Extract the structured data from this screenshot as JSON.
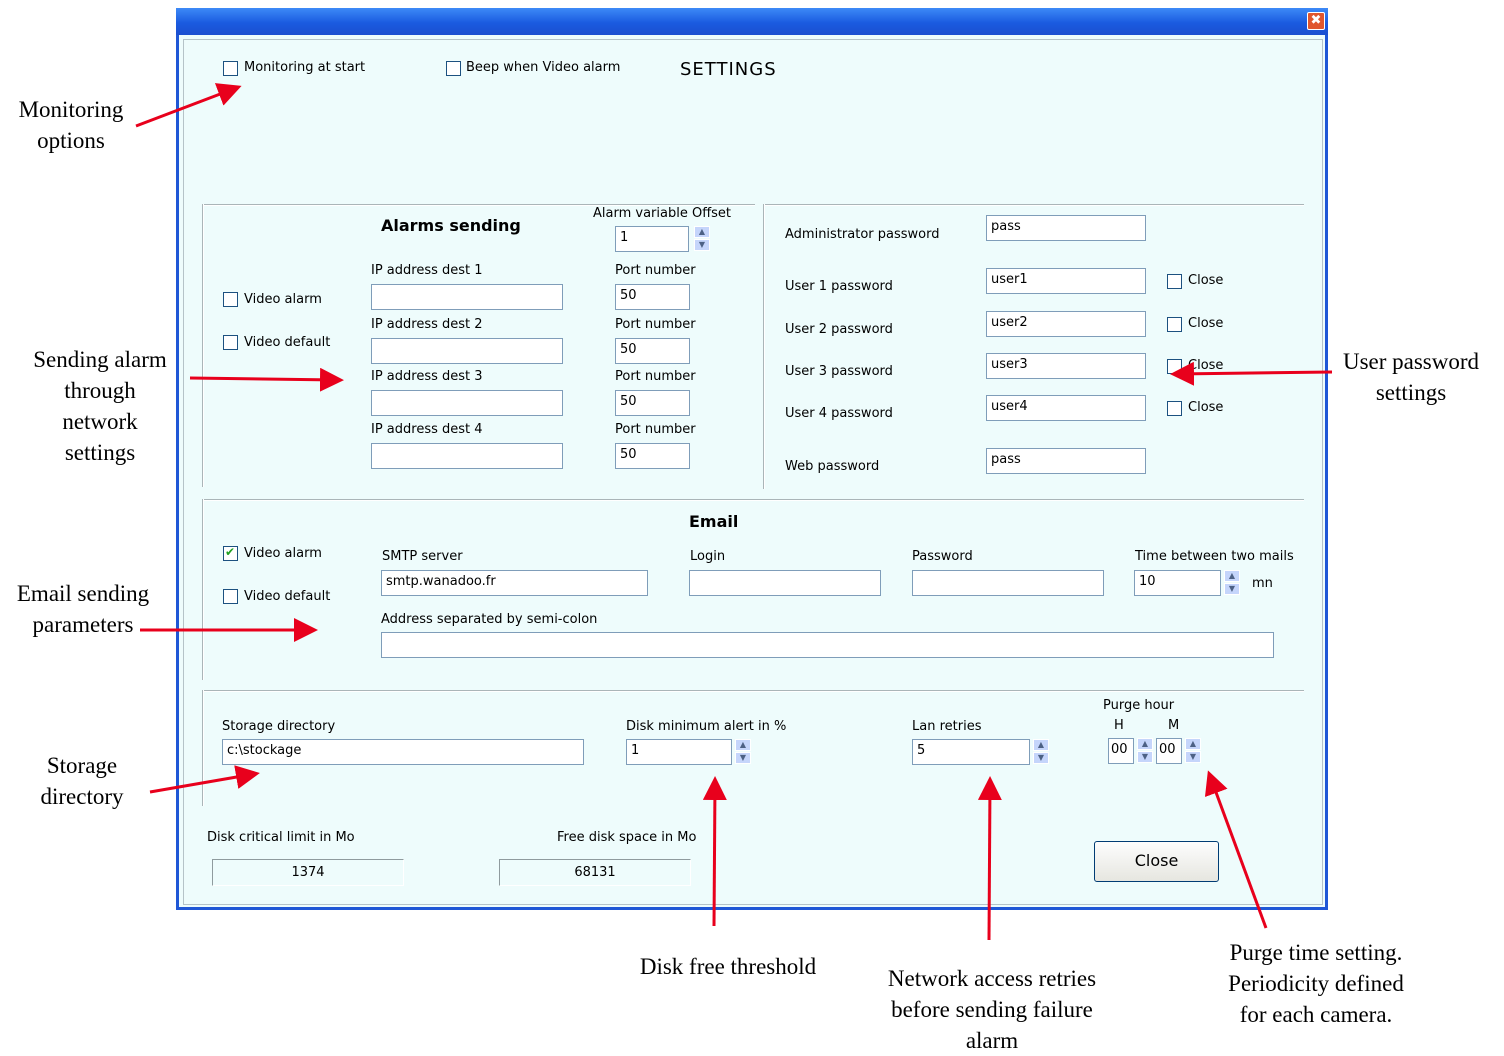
{
  "window": {
    "title": "SETTINGS",
    "close_glyph": "✖"
  },
  "top_options": {
    "monitoring_at_start": "Monitoring at start",
    "beep_video_alarm": "Beep when Video alarm"
  },
  "alarms": {
    "header": "Alarms sending",
    "offset_label": "Alarm variable Offset",
    "offset_value": "1",
    "video_alarm": "Video alarm",
    "video_default": "Video default",
    "dests": [
      {
        "label": "IP address dest 1",
        "ip": "",
        "port_label": "Port number",
        "port": "50"
      },
      {
        "label": "IP address dest 2",
        "ip": "",
        "port_label": "Port number",
        "port": "50"
      },
      {
        "label": "IP address dest 3",
        "ip": "",
        "port_label": "Port number",
        "port": "50"
      },
      {
        "label": "IP address dest 4",
        "ip": "",
        "port_label": "Port number",
        "port": "50"
      }
    ]
  },
  "passwords": {
    "admin_label": "Administrator password",
    "admin_value": "pass",
    "users": [
      {
        "label": "User 1 password",
        "value": "user1",
        "close_label": "Close"
      },
      {
        "label": "User 2 password",
        "value": "user2",
        "close_label": "Close"
      },
      {
        "label": "User 3 password",
        "value": "user3",
        "close_label": "Close"
      },
      {
        "label": "User 4 password",
        "value": "user4",
        "close_label": "Close"
      }
    ],
    "web_label": "Web password",
    "web_value": "pass"
  },
  "email": {
    "header": "Email",
    "video_alarm": "Video alarm",
    "video_alarm_checked": true,
    "video_default": "Video default",
    "smtp_label": "SMTP server",
    "smtp_value": "smtp.wanadoo.fr",
    "login_label": "Login",
    "login_value": "",
    "password_label": "Password",
    "password_value": "",
    "time_label": "Time between two mails",
    "time_value": "10",
    "time_unit": "mn",
    "address_label": "Address separated by semi-colon",
    "address_value": ""
  },
  "storage": {
    "dir_label": "Storage directory",
    "dir_value": "c:\\stockage",
    "disk_min_label": "Disk minimum alert in %",
    "disk_min_value": "1",
    "lan_label": "Lan retries",
    "lan_value": "5",
    "purge_label": "Purge hour",
    "purge_h_label": "H",
    "purge_m_label": "M",
    "purge_h": "00",
    "purge_m": "00"
  },
  "disk": {
    "critical_label": "Disk critical limit in Mo",
    "critical_value": "1374",
    "free_label": "Free disk space in Mo",
    "free_value": "68131"
  },
  "close_button": "Close",
  "spin_up": "▲",
  "spin_down": "▼",
  "annotations": {
    "monitoring": [
      "Monitoring",
      "options"
    ],
    "sending": [
      "Sending alarm",
      "through",
      "network",
      "settings"
    ],
    "user_password": [
      "User password",
      "settings"
    ],
    "email_params": [
      "Email sending",
      "parameters"
    ],
    "storage": [
      "Storage",
      "directory"
    ],
    "disk_free": [
      "Disk free threshold"
    ],
    "network_retries": [
      "Network access retries",
      "before sending failure",
      "alarm"
    ],
    "purge": [
      "Purge time setting.",
      "Periodicity defined",
      "for each camera."
    ]
  },
  "colors": {
    "arrow": "#e8001c",
    "window_bg": "#eefcfc",
    "titlebar": "#1f57d6"
  }
}
